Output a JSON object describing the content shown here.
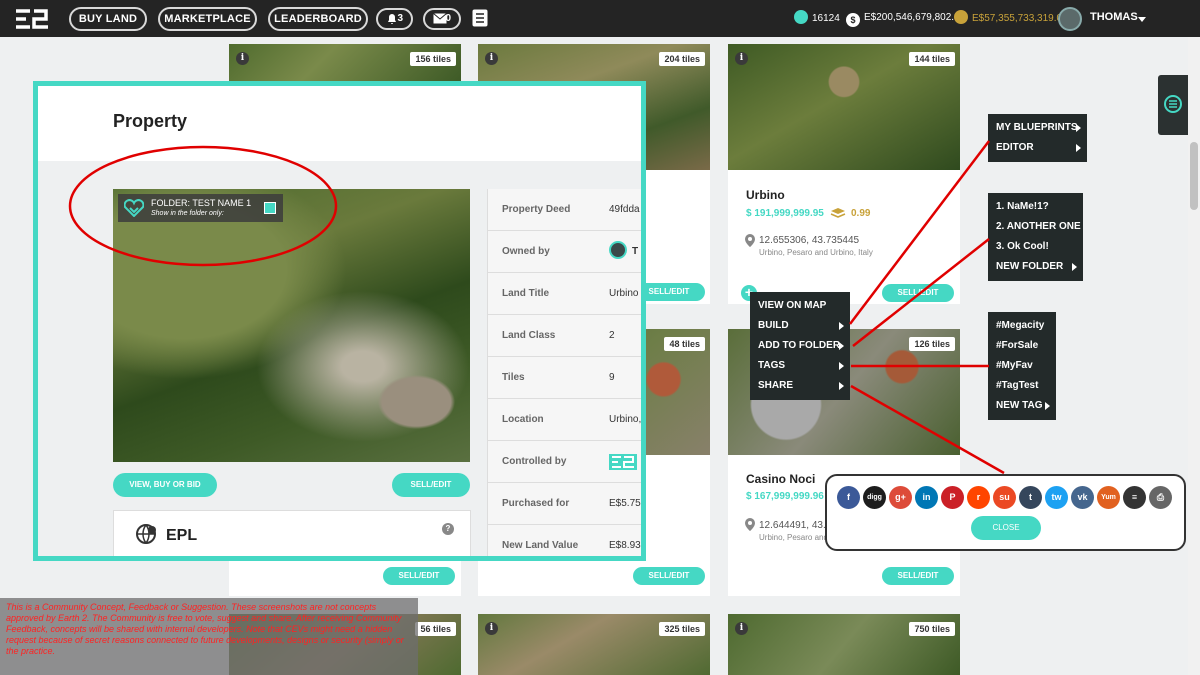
{
  "nav": {
    "buttons": [
      "BUY LAND",
      "MARKETPLACE",
      "LEADERBOARD"
    ],
    "notifications": "3",
    "messages": "0"
  },
  "balances": {
    "coins": "16124",
    "essence": "E$200,546,679,802.34",
    "gold": "E$57,355,733,319.00",
    "coin_color": "#45d8c4",
    "gold_color": "#c8a23a"
  },
  "user": {
    "name": "THOMAS"
  },
  "cards": {
    "top": [
      {
        "tiles": "156 tiles"
      },
      {
        "tiles": "204 tiles"
      },
      {
        "tiles": "144 tiles",
        "title": "Urbino",
        "price": "$ 191,999,999.95",
        "rating": "0.99",
        "coords": "12.655306, 43.735445",
        "place": "Urbino, Pesaro and Urbino, Italy"
      }
    ],
    "mid": [
      {
        "tiles": "48 tiles"
      },
      {
        "tiles": "126 tiles",
        "title": "Casino Noci",
        "price": "$ 167,999,999.96",
        "coords": "12.644491, 43.7",
        "place": "Urbino, Pesaro and"
      }
    ],
    "bottom": [
      {
        "tiles": "56 tiles"
      },
      {
        "tiles": "325 tiles"
      },
      {
        "tiles": "750 tiles"
      }
    ],
    "sell_label": "SELL/EDIT"
  },
  "property": {
    "title": "Property",
    "folder_name": "FOLDER: TEST NAME 1",
    "folder_sub": "Show in the folder only:",
    "view_btn": "VIEW, BUY OR BID",
    "sell_btn": "SELL/EDIT",
    "epl": "EPL",
    "deed": [
      {
        "k": "Property Deed",
        "v": "49fdda"
      },
      {
        "k": "Owned by",
        "v": "T"
      },
      {
        "k": "Land Title",
        "v": "Urbino"
      },
      {
        "k": "Land Class",
        "v": "2"
      },
      {
        "k": "Tiles",
        "v": "9"
      },
      {
        "k": "Location",
        "v": "Urbino,"
      },
      {
        "k": "Controlled by",
        "v": ""
      },
      {
        "k": "Purchased for",
        "v": "E$5.75"
      },
      {
        "k": "New Land Value",
        "v": "E$8.93"
      }
    ]
  },
  "context_menu": [
    "VIEW ON MAP",
    "BUILD",
    "ADD TO FOLDER",
    "TAGS",
    "SHARE"
  ],
  "build_menu": [
    "MY BLUEPRINTS",
    "EDITOR"
  ],
  "folder_menu": [
    "1. NaMe!1?",
    "2. ANOTHER ONE",
    "3. Ok Cool!",
    "NEW FOLDER"
  ],
  "tags_menu": [
    "#Megacity",
    "#ForSale",
    "#MyFav",
    "#TagTest",
    "NEW TAG"
  ],
  "share": {
    "icons": [
      {
        "name": "facebook-icon",
        "label": "f",
        "color": "#3b5998"
      },
      {
        "name": "digg-icon",
        "label": "digg",
        "color": "#1d1d1d"
      },
      {
        "name": "google-plus-icon",
        "label": "g+",
        "color": "#dd4b39"
      },
      {
        "name": "linkedin-icon",
        "label": "in",
        "color": "#0077b5"
      },
      {
        "name": "pinterest-icon",
        "label": "P",
        "color": "#cb2027"
      },
      {
        "name": "reddit-icon",
        "label": "r",
        "color": "#ff4500"
      },
      {
        "name": "stumbleupon-icon",
        "label": "su",
        "color": "#eb4924"
      },
      {
        "name": "tumblr-icon",
        "label": "t",
        "color": "#35465c"
      },
      {
        "name": "twitter-icon",
        "label": "tw",
        "color": "#1da1f2"
      },
      {
        "name": "vk-icon",
        "label": "vk",
        "color": "#45668e"
      },
      {
        "name": "yummly-icon",
        "label": "Yum",
        "color": "#e16120"
      },
      {
        "name": "buffer-icon",
        "label": "≡",
        "color": "#333333"
      },
      {
        "name": "print-icon",
        "label": "⎙",
        "color": "#666666"
      }
    ],
    "close": "CLOSE"
  },
  "disclaimer": "This is a Community Concept, Feedback or Suggestion. These screenshots are not concepts approved by Earth 2. The Community is free to vote, suggest and share. After receiving Community Feedback, concepts will be shared with internal developers. Note that CEVs might need a hidden request because of secret reasons connected to future developments, designs or security (simply or the practice."
}
